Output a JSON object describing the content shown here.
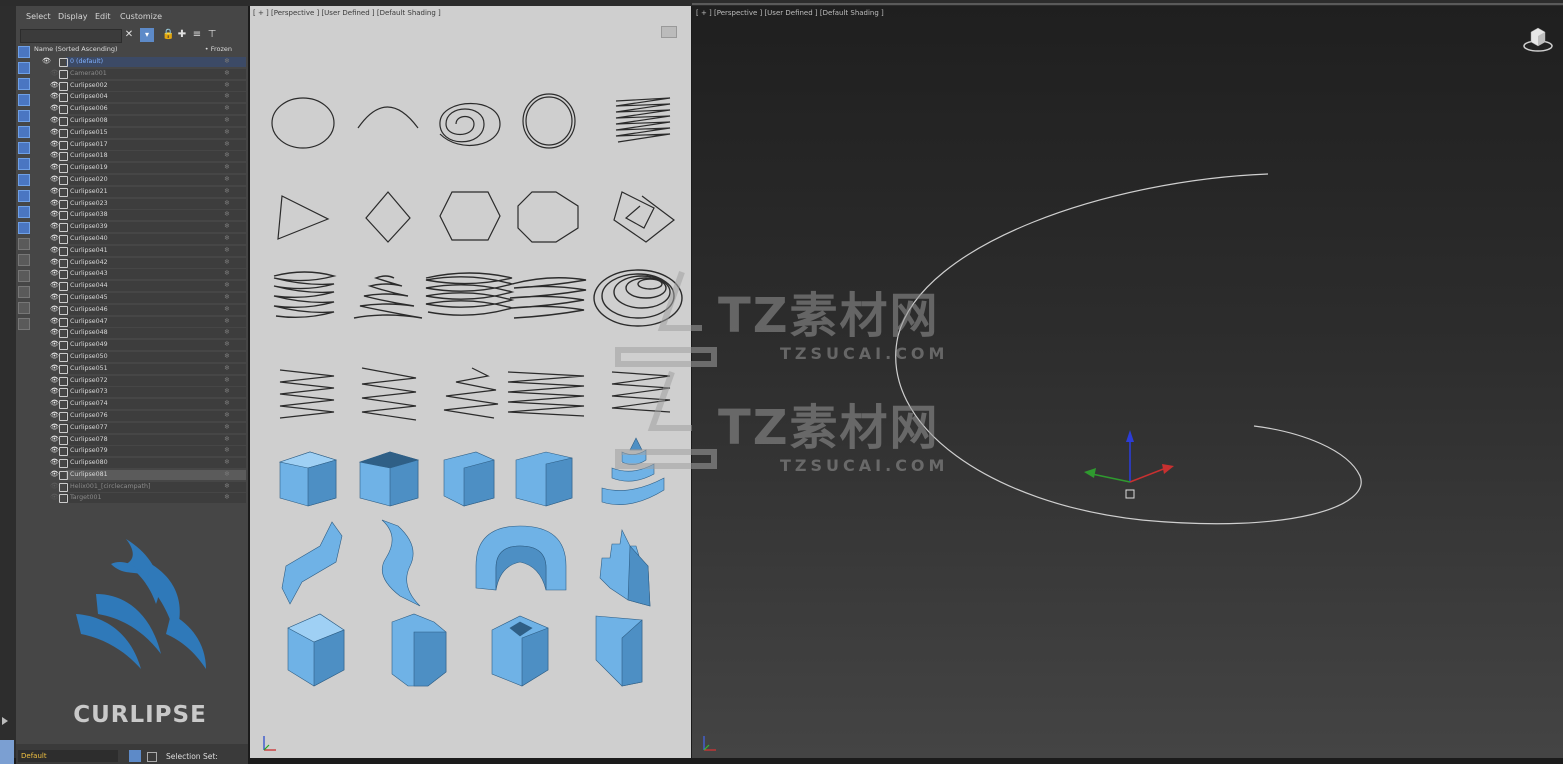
{
  "menu": {
    "items": [
      "Select",
      "Display",
      "Edit",
      "Customize"
    ]
  },
  "explorer": {
    "col_name": "Name (Sorted Ascending)",
    "col_frozen": "• Frozen",
    "rows": [
      {
        "label": "0 (default)",
        "type": "layer"
      },
      {
        "label": "Camera001",
        "type": "dim"
      },
      {
        "label": "Curlipse002",
        "type": "normal"
      },
      {
        "label": "Curlipse004",
        "type": "normal"
      },
      {
        "label": "Curlipse006",
        "type": "normal"
      },
      {
        "label": "Curlipse008",
        "type": "normal"
      },
      {
        "label": "Curlipse015",
        "type": "normal"
      },
      {
        "label": "Curlipse017",
        "type": "normal"
      },
      {
        "label": "Curlipse018",
        "type": "normal"
      },
      {
        "label": "Curlipse019",
        "type": "normal"
      },
      {
        "label": "Curlipse020",
        "type": "normal"
      },
      {
        "label": "Curlipse021",
        "type": "normal"
      },
      {
        "label": "Curlipse023",
        "type": "normal"
      },
      {
        "label": "Curlipse038",
        "type": "normal"
      },
      {
        "label": "Curlipse039",
        "type": "normal"
      },
      {
        "label": "Curlipse040",
        "type": "normal"
      },
      {
        "label": "Curlipse041",
        "type": "normal"
      },
      {
        "label": "Curlipse042",
        "type": "normal"
      },
      {
        "label": "Curlipse043",
        "type": "normal"
      },
      {
        "label": "Curlipse044",
        "type": "normal"
      },
      {
        "label": "Curlipse045",
        "type": "normal"
      },
      {
        "label": "Curlipse046",
        "type": "normal"
      },
      {
        "label": "Curlipse047",
        "type": "normal"
      },
      {
        "label": "Curlipse048",
        "type": "normal"
      },
      {
        "label": "Curlipse049",
        "type": "normal"
      },
      {
        "label": "Curlipse050",
        "type": "normal"
      },
      {
        "label": "Curlipse051",
        "type": "normal"
      },
      {
        "label": "Curlipse072",
        "type": "normal"
      },
      {
        "label": "Curlipse073",
        "type": "normal"
      },
      {
        "label": "Curlipse074",
        "type": "normal"
      },
      {
        "label": "Curlipse076",
        "type": "normal"
      },
      {
        "label": "Curlipse077",
        "type": "normal"
      },
      {
        "label": "Curlipse078",
        "type": "normal"
      },
      {
        "label": "Curlipse079",
        "type": "normal"
      },
      {
        "label": "Curlipse080",
        "type": "normal"
      },
      {
        "label": "Curlipse081",
        "type": "sel"
      },
      {
        "label": "Helix001_[circlecampath]",
        "type": "dim"
      },
      {
        "label": "Target001",
        "type": "dim"
      }
    ]
  },
  "brand": {
    "name": "CURLIPSE",
    "logo_icon": "curlipse-swirl-logo",
    "logo_color": "#2f79b9"
  },
  "bottom": {
    "layer_value": "Default",
    "selection_set_label": "Selection Set:"
  },
  "viewport_left": {
    "label": "[ + ] [Perspective ] [User Defined ] [Default Shading ]"
  },
  "viewport_right": {
    "label": "[ + ] [Perspective ] [User Defined ] [Default Shading ]"
  },
  "watermark": {
    "text_cn": "TZ素材网",
    "text_url": "TZSUCAI.COM"
  },
  "colors": {
    "shape_blue": "#6fb2e6",
    "selection_blue": "#5d8ac8",
    "layer_text": "#7fb0ff"
  }
}
